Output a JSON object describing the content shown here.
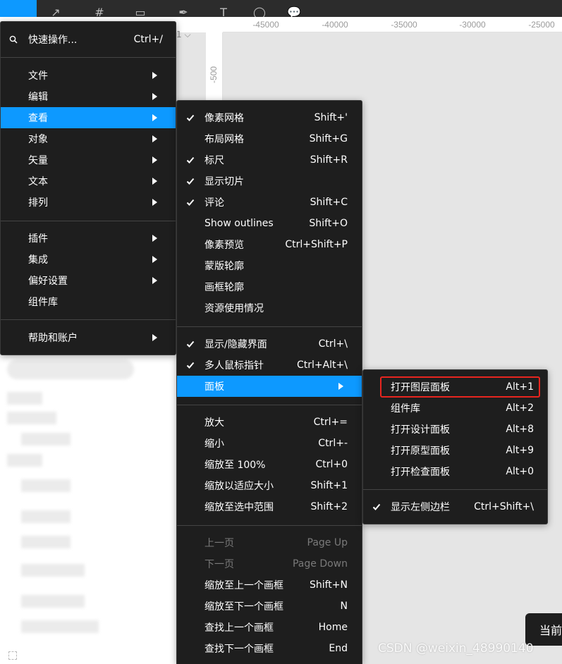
{
  "ruler": {
    "ticks": [
      "-45000",
      "-40000",
      "-35000",
      "-30000",
      "-25000"
    ],
    "left_tick": "-500",
    "zoom_fragment": "1 ⌵"
  },
  "main_menu": {
    "quick_actions_label": "快速操作...",
    "quick_actions_shortcut": "Ctrl+/",
    "items": [
      {
        "label": "文件"
      },
      {
        "label": "编辑"
      },
      {
        "label": "查看"
      },
      {
        "label": "对象"
      },
      {
        "label": "矢量"
      },
      {
        "label": "文本"
      },
      {
        "label": "排列"
      },
      {
        "label": "插件"
      },
      {
        "label": "集成"
      },
      {
        "label": "偏好设置"
      },
      {
        "label": "组件库"
      },
      {
        "label": "帮助和账户"
      }
    ]
  },
  "view_menu": {
    "items": [
      {
        "label": "像素网格",
        "shortcut": "Shift+'"
      },
      {
        "label": "布局网格",
        "shortcut": "Shift+G"
      },
      {
        "label": "标尺",
        "shortcut": "Shift+R"
      },
      {
        "label": "显示切片",
        "shortcut": ""
      },
      {
        "label": "评论",
        "shortcut": "Shift+C"
      },
      {
        "label": "Show outlines",
        "shortcut": "Shift+O"
      },
      {
        "label": "像素预览",
        "shortcut": "Ctrl+Shift+P"
      },
      {
        "label": "蒙版轮廓",
        "shortcut": ""
      },
      {
        "label": "画框轮廓",
        "shortcut": ""
      },
      {
        "label": "资源使用情况",
        "shortcut": ""
      },
      {
        "label": "显示/隐藏界面",
        "shortcut": "Ctrl+\\"
      },
      {
        "label": "多人鼠标指针",
        "shortcut": "Ctrl+Alt+\\"
      },
      {
        "label": "面板",
        "shortcut": ""
      },
      {
        "label": "放大",
        "shortcut": "Ctrl+="
      },
      {
        "label": "缩小",
        "shortcut": "Ctrl+-"
      },
      {
        "label": "缩放至 100%",
        "shortcut": "Ctrl+0"
      },
      {
        "label": "缩放以适应大小",
        "shortcut": "Shift+1"
      },
      {
        "label": "缩放至选中范围",
        "shortcut": "Shift+2"
      },
      {
        "label": "上一页",
        "shortcut": "Page Up"
      },
      {
        "label": "下一页",
        "shortcut": "Page Down"
      },
      {
        "label": "缩放至上一个画框",
        "shortcut": "Shift+N"
      },
      {
        "label": "缩放至下一个画框",
        "shortcut": "N"
      },
      {
        "label": "查找上一个画框",
        "shortcut": "Home"
      },
      {
        "label": "查找下一个画框",
        "shortcut": "End"
      }
    ]
  },
  "panel_menu": {
    "items": [
      {
        "label": "打开图层面板",
        "shortcut": "Alt+1"
      },
      {
        "label": "组件库",
        "shortcut": "Alt+2"
      },
      {
        "label": "打开设计面板",
        "shortcut": "Alt+8"
      },
      {
        "label": "打开原型面板",
        "shortcut": "Alt+9"
      },
      {
        "label": "打开检查面板",
        "shortcut": "Alt+0"
      },
      {
        "label": "显示左侧边栏",
        "shortcut": "Ctrl+Shift+\\"
      }
    ]
  },
  "toast": {
    "text": "当前"
  },
  "watermark": "CSDN @weixin_48990140",
  "colors": {
    "accent": "#0d99ff",
    "menu_bg": "#1e1e1e",
    "highlight_box": "#e8251f"
  }
}
